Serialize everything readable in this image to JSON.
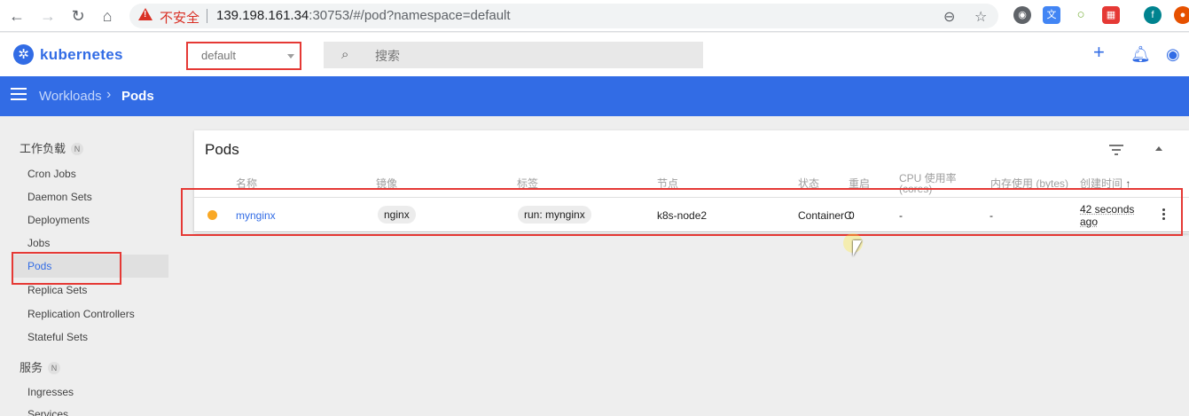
{
  "browser": {
    "insecure_label": "不安全",
    "url_host": "139.198.161.34",
    "url_rest": ":30753/#/pod?namespace=default"
  },
  "header": {
    "app_title": "kubernetes",
    "namespace": "default",
    "search_placeholder": "搜索"
  },
  "toolbar": {
    "breadcrumb_parent": "Workloads",
    "breadcrumb_current": "Pods"
  },
  "sidebar": {
    "section_workloads": "工作负载",
    "section_badge": "N",
    "items": [
      "Cron Jobs",
      "Daemon Sets",
      "Deployments",
      "Jobs",
      "Pods",
      "Replica Sets",
      "Replication Controllers",
      "Stateful Sets"
    ],
    "section_services": "服务",
    "service_items": [
      "Ingresses",
      "Services"
    ]
  },
  "card": {
    "title": "Pods",
    "columns": {
      "name": "名称",
      "image": "镜像",
      "labels": "标签",
      "node": "节点",
      "status": "状态",
      "restarts": "重启",
      "cpu_line1": "CPU 使用率",
      "cpu_line2": "(cores)",
      "memory": "内存使用 (bytes)",
      "created": "创建时间",
      "sort_arrow": "↑"
    },
    "rows": [
      {
        "name": "mynginx",
        "image": "nginx",
        "labels": "run: mynginx",
        "node": "k8s-node2",
        "status": "ContainerC",
        "restarts": "0",
        "cpu": "-",
        "memory": "-",
        "created_line1": "42 seconds",
        "created_line2": "ago"
      }
    ]
  },
  "colors": {
    "brand": "#326ce5",
    "highlight": "#e53935",
    "pending": "#f9a825"
  }
}
